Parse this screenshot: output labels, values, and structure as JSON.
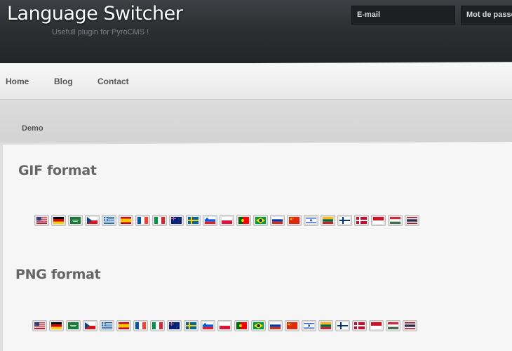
{
  "header": {
    "title": "Language Switcher",
    "tagline": "Usefull plugin for PyroCMS !",
    "email_placeholder": "E-mail",
    "password_placeholder": "Mot de passe"
  },
  "nav": {
    "items": [
      {
        "label": "Home"
      },
      {
        "label": "Blog"
      },
      {
        "label": "Contact"
      }
    ]
  },
  "subnav": {
    "items": [
      {
        "label": "Demo"
      }
    ]
  },
  "sections": [
    {
      "title": "GIF format"
    },
    {
      "title": "PNG format"
    }
  ],
  "flags": [
    {
      "icon": "flag-us-icon"
    },
    {
      "icon": "flag-germany-icon"
    },
    {
      "icon": "flag-saudi-arabia-icon"
    },
    {
      "icon": "flag-czech-icon"
    },
    {
      "icon": "flag-greece-icon"
    },
    {
      "icon": "flag-spain-icon"
    },
    {
      "icon": "flag-france-icon"
    },
    {
      "icon": "flag-italy-icon"
    },
    {
      "icon": "flag-new-zealand-icon"
    },
    {
      "icon": "flag-sweden-icon"
    },
    {
      "icon": "flag-slovenia-icon"
    },
    {
      "icon": "flag-poland-icon"
    },
    {
      "icon": "flag-portugal-icon"
    },
    {
      "icon": "flag-brazil-icon"
    },
    {
      "icon": "flag-russia-icon"
    },
    {
      "icon": "flag-china-icon"
    },
    {
      "icon": "flag-israel-icon"
    },
    {
      "icon": "flag-lithuania-icon"
    },
    {
      "icon": "flag-finland-icon"
    },
    {
      "icon": "flag-denmark-icon"
    },
    {
      "icon": "flag-indonesia-icon"
    },
    {
      "icon": "flag-hungary-icon"
    },
    {
      "icon": "flag-thailand-icon"
    }
  ]
}
